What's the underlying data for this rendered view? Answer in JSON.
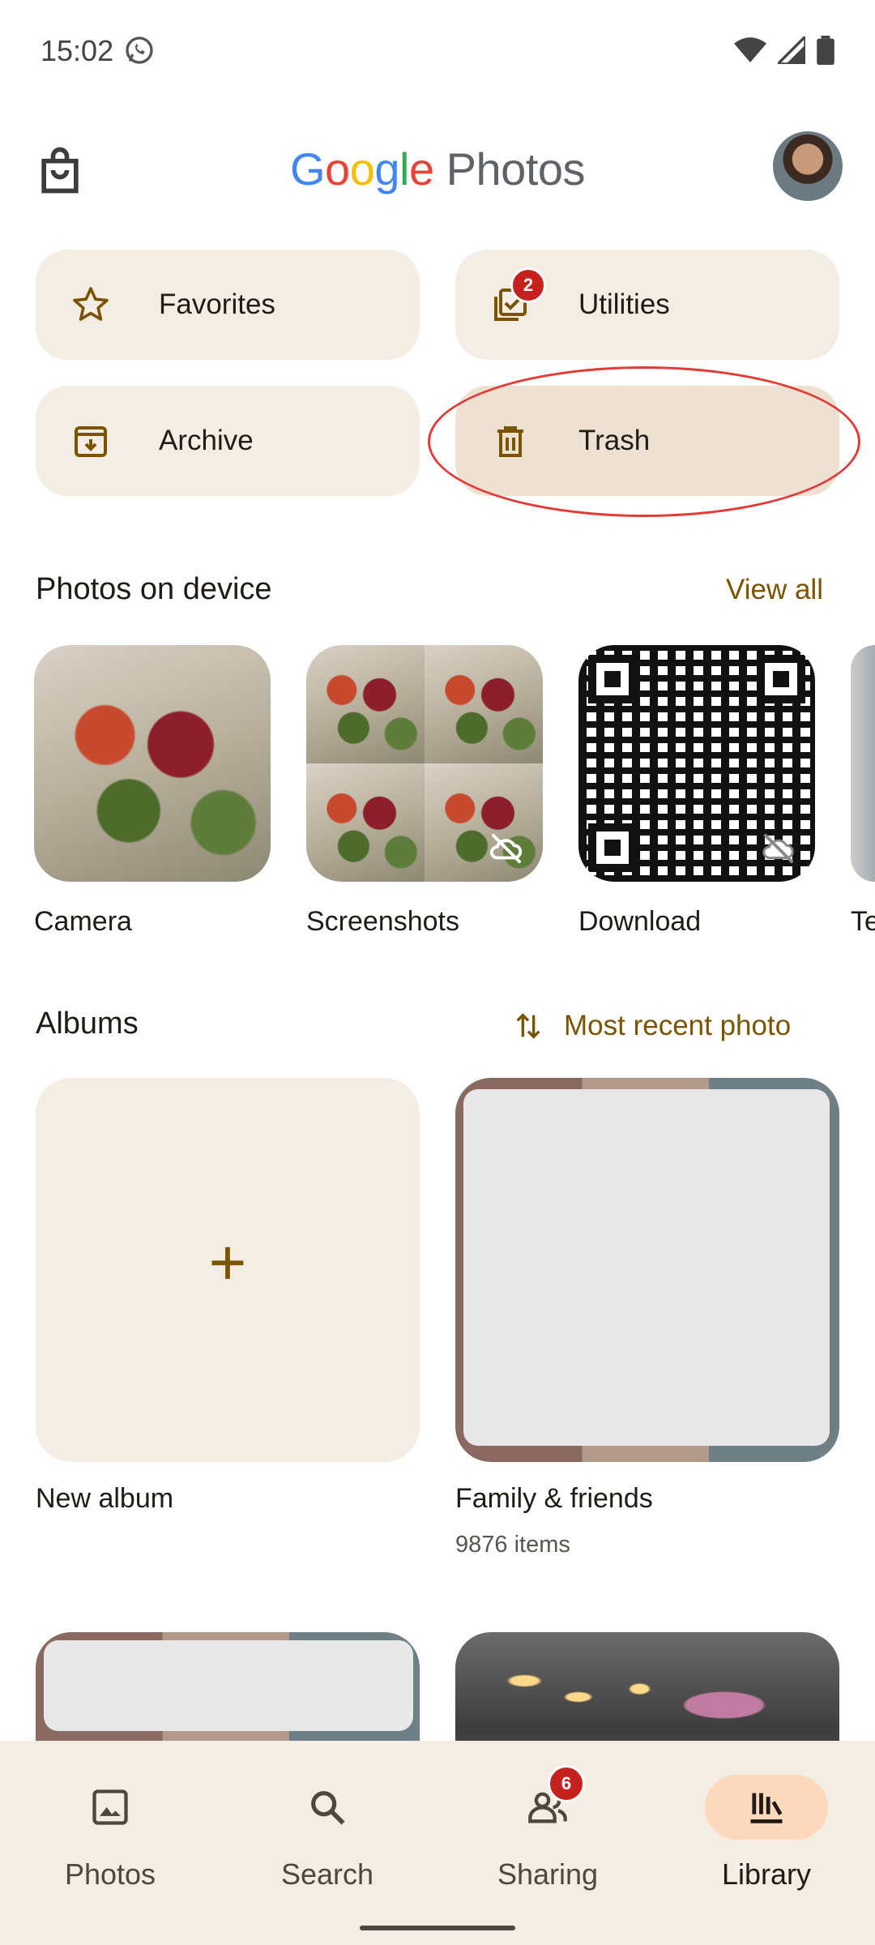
{
  "status_bar": {
    "time": "15:02"
  },
  "app_bar": {
    "logo_google": [
      "G",
      "o",
      "o",
      "g",
      "l",
      "e"
    ],
    "logo_product": "Photos"
  },
  "quick_access": {
    "favorites": "Favorites",
    "utilities": "Utilities",
    "utilities_badge": "2",
    "archive": "Archive",
    "trash": "Trash"
  },
  "device_section": {
    "title": "Photos on device",
    "action": "View all",
    "folders": [
      {
        "label": "Camera"
      },
      {
        "label": "Screenshots"
      },
      {
        "label": "Download"
      },
      {
        "label": "Te"
      }
    ]
  },
  "albums_section": {
    "title": "Albums",
    "sort_label": "Most recent photo",
    "new_album": {
      "plus": "+",
      "label": "New album"
    },
    "albums": [
      {
        "label": "Family & friends",
        "count": "9876 items"
      }
    ]
  },
  "bottom_nav": {
    "items": [
      {
        "label": "Photos"
      },
      {
        "label": "Search"
      },
      {
        "label": "Sharing",
        "badge": "6"
      },
      {
        "label": "Library"
      }
    ],
    "active": "Library"
  },
  "colors": {
    "accent": "#7a5400",
    "chip_bg": "#f4ede4",
    "selected_chip_bg": "#efe1d2",
    "active_nav_pill": "#fcd9bd",
    "badge": "#c5221f",
    "highlight_ring": "#e53935"
  },
  "icons": {
    "status": [
      "whatsapp-icon",
      "wifi-icon",
      "signal-icon",
      "battery-icon"
    ],
    "app_bar": [
      "shopping-bag-icon"
    ],
    "chips": [
      "star-icon",
      "utilities-icon",
      "archive-icon",
      "trash-icon"
    ],
    "sort": "sort-arrows-icon",
    "nav": [
      "photo-icon",
      "search-icon",
      "people-icon",
      "library-icon"
    ]
  }
}
